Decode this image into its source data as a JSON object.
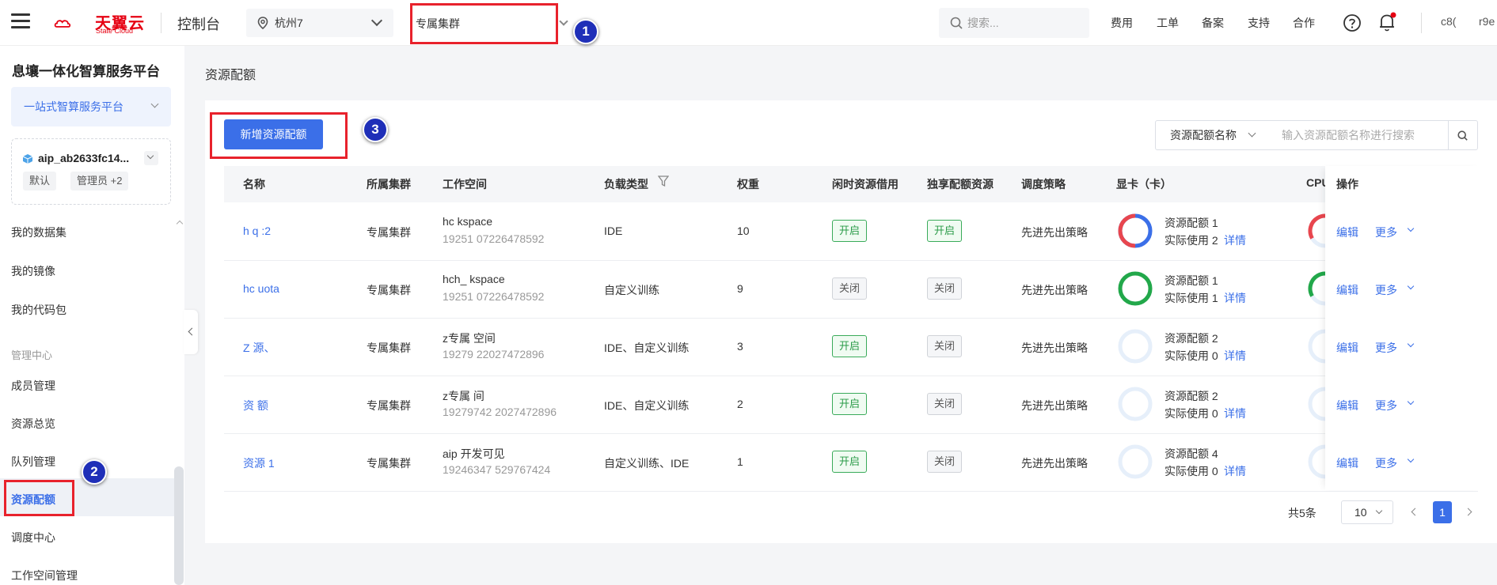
{
  "header": {
    "logo_text": "天翼云",
    "logo_sub": "State Cloud",
    "console": "控制台",
    "region": "杭州7",
    "cluster": "专属集群",
    "search_placeholder": "搜索...",
    "nav": [
      "费用",
      "工单",
      "备案",
      "支持",
      "合作"
    ],
    "user_part1": "c8(",
    "user_part2": "r9e"
  },
  "sidebar": {
    "platform_title": "息壤一体化智算服务平台",
    "platform_select": "一站式智算服务平台",
    "account_name": "aip_ab2633fc14...",
    "tag_default": "默认",
    "tag_role": "管理员 +2",
    "items": [
      "我的数据集",
      "我的镜像",
      "我的代码包"
    ],
    "section_manage": "管理中心",
    "manage_items": [
      "成员管理",
      "资源总览",
      "队列管理",
      "资源配额",
      "调度中心",
      "工作空间管理"
    ]
  },
  "main": {
    "page_title": "资源配额",
    "add_button": "新增资源配额",
    "filter_field": "资源配额名称",
    "filter_placeholder": "输入资源配额名称进行搜索",
    "columns": [
      "名称",
      "所属集群",
      "工作空间",
      "负载类型",
      "权重",
      "闲时资源借用",
      "独享配额资源",
      "调度策略",
      "显卡（卡）",
      "CPU",
      "操作"
    ],
    "rows": [
      {
        "name": "h    q    :2",
        "cluster": "专属集群",
        "ws_name": "hc        kspace",
        "ws_id": "19251         07226478592",
        "load": "IDE",
        "weight": "10",
        "idle": "开启",
        "exclusive": "开启",
        "policy": "先进先出策略",
        "gpu_quota": "资源配额 1",
        "gpu_used": "实际使用 2",
        "detail": "详情",
        "edit": "编辑",
        "more": "更多"
      },
      {
        "name": "hc   uota",
        "cluster": "专属集群",
        "ws_name": "hch_      kspace",
        "ws_id": "19251         07226478592",
        "load": "自定义训练",
        "weight": "9",
        "idle": "关闭",
        "exclusive": "关闭",
        "policy": "先进先出策略",
        "gpu_quota": "资源配额 1",
        "gpu_used": "实际使用 1",
        "detail": "详情",
        "edit": "编辑",
        "more": "更多"
      },
      {
        "name": "Z     源、   ",
        "cluster": "专属集群",
        "ws_name": "z专属      空间",
        "ws_id": "19279       22027472896",
        "load": "IDE、自定义训练",
        "weight": "3",
        "idle": "开启",
        "exclusive": "关闭",
        "policy": "先进先出策略",
        "gpu_quota": "资源配额 2",
        "gpu_used": "实际使用 0",
        "detail": "详情",
        "edit": "编辑",
        "more": "更多"
      },
      {
        "name": "资     额",
        "cluster": "专属集群",
        "ws_name": "z专属       间",
        "ws_id": "19279742 2027472896",
        "load": "IDE、自定义训练",
        "weight": "2",
        "idle": "开启",
        "exclusive": "关闭",
        "policy": "先进先出策略",
        "gpu_quota": "资源配额 2",
        "gpu_used": "实际使用 0",
        "detail": "详情",
        "edit": "编辑",
        "more": "更多"
      },
      {
        "name": "资源    1",
        "cluster": "专属集群",
        "ws_name": "aip      开发可见",
        "ws_id": "19246347     529767424",
        "load": "自定义训练、IDE",
        "weight": "1",
        "idle": "开启",
        "exclusive": "关闭",
        "policy": "先进先出策略",
        "gpu_quota": "资源配额 4",
        "gpu_used": "实际使用 0",
        "detail": "详情",
        "edit": "编辑",
        "more": "更多"
      }
    ],
    "pager_total": "共5条",
    "pager_size": "10",
    "pager_current": "1"
  },
  "annotations": [
    "1",
    "2",
    "3"
  ],
  "colors": {
    "primary": "#3b6fe8",
    "annotation_red": "#e8222c",
    "badge_blue": "#1f2fb8",
    "brand_red": "#e60012"
  },
  "ring_usage": [
    {
      "gpu_fraction": 1.0,
      "gpu_color": "#3b6fe8",
      "cpu_fraction": 0.35,
      "cpu_color": "#e8464e"
    },
    {
      "gpu_fraction": 1.0,
      "gpu_color": "#22a84a",
      "cpu_fraction": 0.35,
      "cpu_color": "#22a84a"
    },
    {
      "gpu_fraction": 0,
      "gpu_color": "#e6effa",
      "cpu_fraction": 0,
      "cpu_color": "#e6effa"
    },
    {
      "gpu_fraction": 0,
      "gpu_color": "#e6effa",
      "cpu_fraction": 0,
      "cpu_color": "#e6effa"
    },
    {
      "gpu_fraction": 0,
      "gpu_color": "#e6effa",
      "cpu_fraction": 0,
      "cpu_color": "#e6effa"
    }
  ]
}
